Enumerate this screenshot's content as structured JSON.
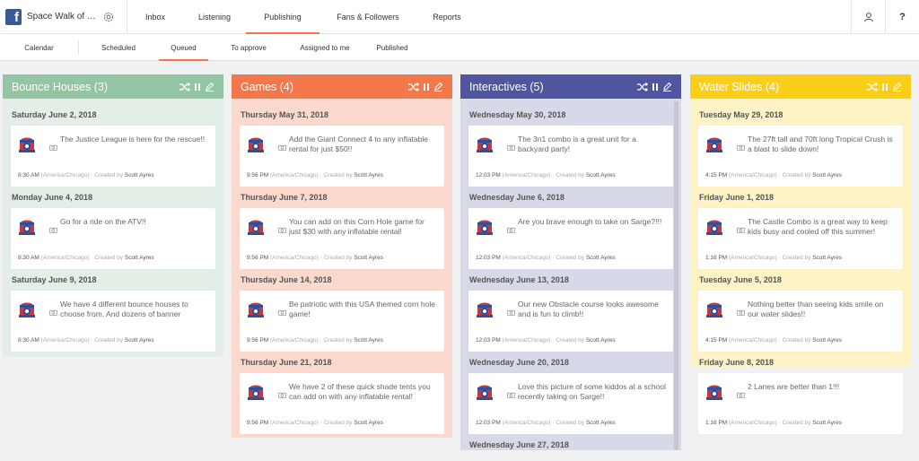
{
  "brand": {
    "name": "Space Walk of C...",
    "logo_letter": "f"
  },
  "nav": {
    "items": [
      "Inbox",
      "Listening",
      "Publishing",
      "Fans & Followers",
      "Reports"
    ],
    "active": "Publishing",
    "help": "?"
  },
  "subnav": {
    "items": [
      "Calendar",
      "Scheduled",
      "Queued",
      "To approve",
      "Assigned to me",
      "Published"
    ],
    "active": "Queued"
  },
  "timezone": "(America/Chicago)",
  "created_prefix": "· Created by",
  "columns": [
    {
      "title": "Bounce Houses (3)",
      "color": "#93c5a4",
      "bg": "#e3efe6",
      "groups": [
        {
          "date": "Saturday June 2, 2018",
          "text": "The Justice League is here for the rescue!!",
          "time": "8:30 AM",
          "author": "Scott Ayres"
        },
        {
          "date": "Monday June 4, 2018",
          "text": "Go for a ride on the ATV!!",
          "time": "8:30 AM",
          "author": "Scott Ayres"
        },
        {
          "date": "Saturday June 9, 2018",
          "text": "We have 4 different bounce houses to choose from. And dozens of banner",
          "time": "8:30 AM",
          "author": "Scott Ayres"
        }
      ]
    },
    {
      "title": "Games (4)",
      "color": "#f2784b",
      "bg": "#fbd9cc",
      "groups": [
        {
          "date": "Thursday May 31, 2018",
          "text": "Add the Giant Connect 4 to any inflatable rental for just $50!!",
          "time": "9:56 PM",
          "author": "Scott Ayres"
        },
        {
          "date": "Thursday June 7, 2018",
          "text": "You can add on this Corn Hole game for just $30 with any inflatable rental!",
          "time": "9:56 PM",
          "author": "Scott Ayres"
        },
        {
          "date": "Thursday June 14, 2018",
          "text": "Be patriotic with this USA themed corn hole game!",
          "time": "9:56 PM",
          "author": "Scott Ayres"
        },
        {
          "date": "Thursday June 21, 2018",
          "text": "We have 2 of these quick shade tents you can add on with any inflatable rental!",
          "time": "9:56 PM",
          "author": "Scott Ayres"
        }
      ]
    },
    {
      "title": "Interactives (5)",
      "color": "#5055a0",
      "bg": "#d8d9e8",
      "groups": [
        {
          "date": "Wednesday May 30, 2018",
          "text": "The 3n1 combo is a great unit for a backyard party!",
          "time": "12:03 PM",
          "author": "Scott Ayres"
        },
        {
          "date": "Wednesday June 6, 2018",
          "text": "Are you brave enough to take on Sarge?!!!",
          "time": "12:03 PM",
          "author": "Scott Ayres"
        },
        {
          "date": "Wednesday June 13, 2018",
          "text": "Our new Obstacle course looks awesome and is fun to climb!!",
          "time": "12:03 PM",
          "author": "Scott Ayres"
        },
        {
          "date": "Wednesday June 20, 2018",
          "text": "Love this picture of some kiddos at a school recently taking on Sarge!!",
          "time": "12:03 PM",
          "author": "Scott Ayres"
        },
        {
          "date": "Wednesday June 27, 2018",
          "text": "",
          "time": "",
          "author": ""
        }
      ]
    },
    {
      "title": "Water Slides (4)",
      "color": "#fbcf19",
      "bg": "#fdf3c4",
      "groups": [
        {
          "date": "Tuesday May 29, 2018",
          "text": "The 27ft tall and 70ft long Tropical Crush is a blast to slide down!",
          "time": "4:15 PM",
          "author": "Scott Ayres"
        },
        {
          "date": "Friday June 1, 2018",
          "text": "The Castle Combo is a great way to keep kids busy and cooled off this summer!",
          "time": "1:16 PM",
          "author": "Scott Ayres"
        },
        {
          "date": "Tuesday June 5, 2018",
          "text": "Nothing better than seeing kids smile on our water slides!!",
          "time": "4:15 PM",
          "author": "Scott Ayres"
        },
        {
          "date": "Friday June 8, 2018",
          "text": "2 Lanes are better than 1!!!",
          "time": "1:16 PM",
          "author": "Scott Ayres"
        }
      ]
    }
  ]
}
